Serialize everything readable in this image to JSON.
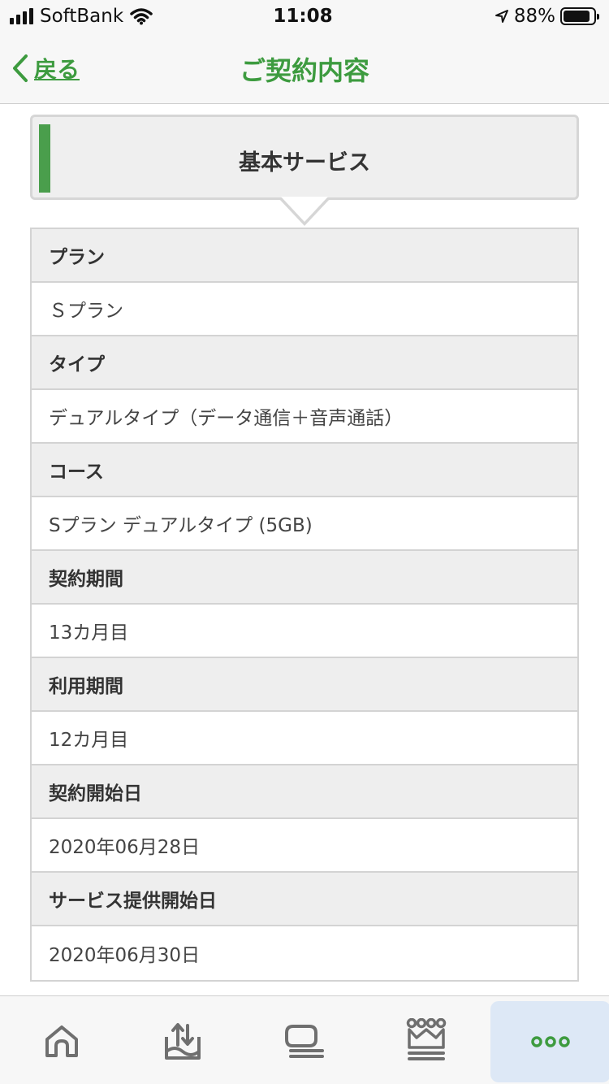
{
  "status_bar": {
    "carrier": "SoftBank",
    "time": "11:08",
    "battery": "88%",
    "battery_level": 0.88
  },
  "nav": {
    "back_label": "戻る",
    "title": "ご契約内容"
  },
  "section": {
    "title": "基本サービス"
  },
  "rows": [
    {
      "label": "プラン",
      "value": "Ｓプラン"
    },
    {
      "label": "タイプ",
      "value": "デュアルタイプ（データ通信＋音声通話）"
    },
    {
      "label": "コース",
      "value": "Sプラン デュアルタイプ (5GB)"
    },
    {
      "label": "契約期間",
      "value": "13カ月目"
    },
    {
      "label": "利用期間",
      "value": "12カ月目"
    },
    {
      "label": "契約開始日",
      "value": "2020年06月28日"
    },
    {
      "label": "サービス提供開始日",
      "value": "2020年06月30日"
    }
  ],
  "tabs": [
    {
      "icon": "home-icon"
    },
    {
      "icon": "data-transfer-icon"
    },
    {
      "icon": "chat-icon"
    },
    {
      "icon": "crown-icon"
    },
    {
      "icon": "more-icon",
      "active": true
    }
  ],
  "colors": {
    "accent_green": "#3d9b3f",
    "icon_gray": "#6f6f6f",
    "active_tab_bg": "#dde8f6"
  }
}
